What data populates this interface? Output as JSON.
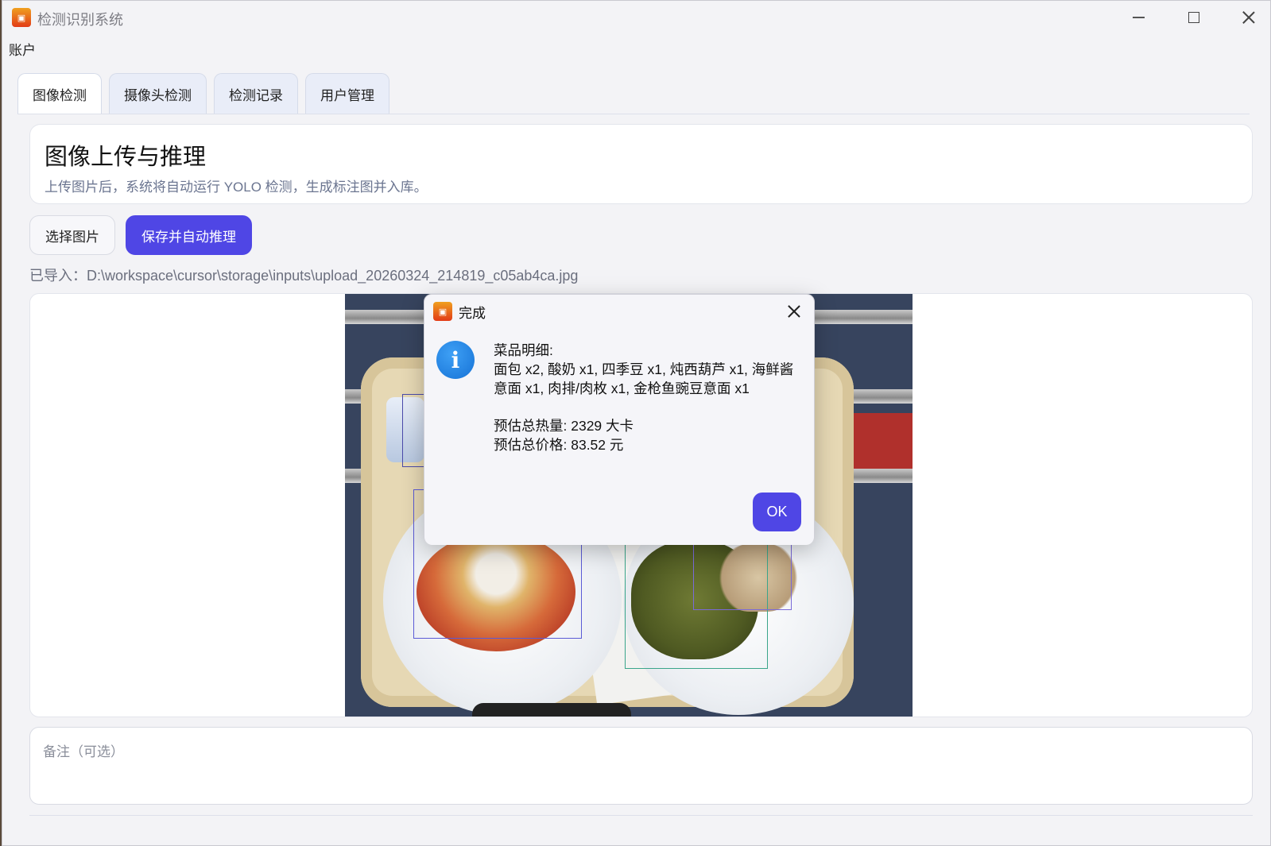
{
  "window": {
    "title": "检测识别系统"
  },
  "menu": {
    "account": "账户"
  },
  "tabs": [
    {
      "label": "图像检测",
      "active": true
    },
    {
      "label": "摄像头检测",
      "active": false
    },
    {
      "label": "检测记录",
      "active": false
    },
    {
      "label": "用户管理",
      "active": false
    }
  ],
  "header": {
    "title": "图像上传与推理",
    "subtitle": "上传图片后，系统将自动运行 YOLO 检测，生成标注图并入库。"
  },
  "actions": {
    "select_label": "选择图片",
    "save_label": "保存并自动推理"
  },
  "file_path": "已导入：D:\\workspace\\cursor\\storage\\inputs\\upload_20260324_214819_c05ab4ca.jpg",
  "notes": {
    "placeholder": "备注（可选）"
  },
  "dialog": {
    "title": "完成",
    "lines": [
      "菜品明细:",
      "面包 x2, 酸奶 x1, 四季豆 x1, 炖西葫芦 x1, 海鲜酱",
      "意面 x1, 肉排/肉枚 x1, 金枪鱼豌豆意面 x1",
      "预估总热量: 2329 大卡",
      "预估总价格: 83.52 元"
    ],
    "ok_label": "OK"
  },
  "colors": {
    "accent": "#4f46e5",
    "info": "#1672d6"
  }
}
